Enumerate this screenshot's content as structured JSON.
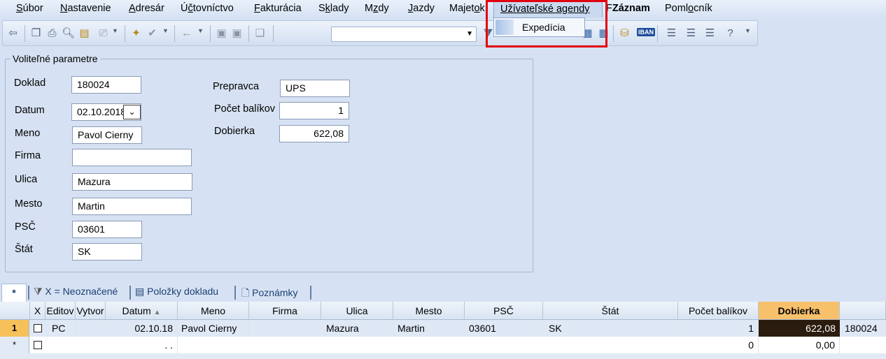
{
  "menubar": {
    "items": [
      {
        "pre": "",
        "u": "S",
        "post": "úbor"
      },
      {
        "pre": "",
        "u": "N",
        "post": "astavenie"
      },
      {
        "pre": "",
        "u": "A",
        "post": "dresár"
      },
      {
        "pre": "Ú",
        "u": "č",
        "post": "tovníctvo"
      },
      {
        "pre": "",
        "u": "F",
        "post": "akturácia"
      },
      {
        "pre": "S",
        "u": "k",
        "post": "lady"
      },
      {
        "pre": "M",
        "u": "z",
        "post": "dy"
      },
      {
        "pre": "",
        "u": "J",
        "post": "azdy"
      },
      {
        "pre": "Majet",
        "u": "o",
        "post": "k"
      },
      {
        "pre": "Poml",
        "u": "o",
        "post": "cník"
      }
    ],
    "open_menu": "Užívateľské agendy",
    "zaznam_prefix": "F",
    "zaznam": "Záznam",
    "dropdown_item": "Expedícia"
  },
  "toolbar": {
    "search_value": ""
  },
  "form": {
    "group_title": "Voliteľné parametre",
    "doklad_label": "Doklad",
    "doklad_value": "180024",
    "datum_label": "Datum",
    "datum_value": "02.10.2018",
    "meno_label": "Meno",
    "meno_value": "Pavol Cierny",
    "firma_label": "Firma",
    "firma_value": "",
    "ulica_label": "Ulica",
    "ulica_value": "Mazura",
    "mesto_label": "Mesto",
    "mesto_value": "Martin",
    "psc_label": "PSČ",
    "psc_value": "03601",
    "stat_label": "Štát",
    "stat_value": "SK",
    "prepravca_label": "Prepravca",
    "prepravca_value": "UPS",
    "pocet_label": "Počet balíkov",
    "pocet_value": "1",
    "dobierka_label": "Dobierka",
    "dobierka_value": "622,08"
  },
  "tabs": {
    "first": "*",
    "items": [
      "X = Neoznačené",
      "Položky dokladu",
      "Poznámky"
    ]
  },
  "grid": {
    "headers": [
      "X",
      "Editov",
      "Vytvor",
      "Datum",
      "Meno",
      "Firma",
      "Ulica",
      "Mesto",
      "PSČ",
      "Štát",
      "Počet balíkov",
      "Dobierka",
      ""
    ],
    "rows": [
      {
        "rowhdr": "1",
        "editov": "PC",
        "datum": "02.10.18",
        "meno": "Pavol Cierny",
        "firma": "",
        "ulica": "Mazura",
        "mesto": "Martin",
        "psc": "03601",
        "stat": "SK",
        "pocet": "1",
        "dobierka": "622,08",
        "doklad": "180024"
      },
      {
        "rowhdr": "*",
        "editov": "",
        "datum": ". .",
        "meno": "",
        "firma": "",
        "ulica": "",
        "mesto": "",
        "psc": "",
        "stat": "",
        "pocet": "0",
        "dobierka": "0,00",
        "doklad": ""
      }
    ]
  }
}
